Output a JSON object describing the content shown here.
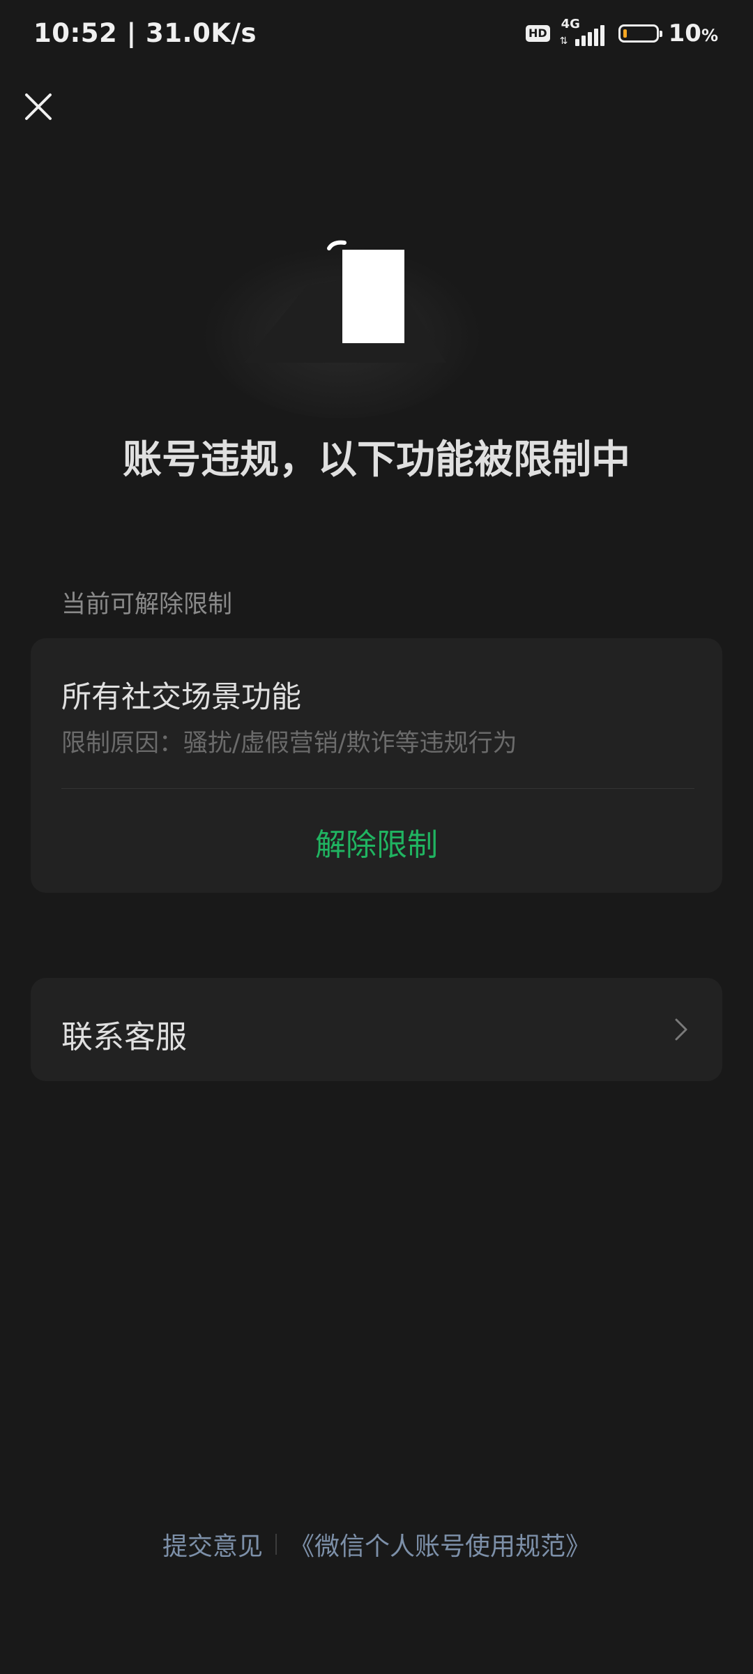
{
  "status_bar": {
    "time_speed": "10:52 | 31.0K/s",
    "hd_label": "HD",
    "network_label": "4G",
    "battery_percent": "10",
    "battery_unit": "%"
  },
  "header": {
    "close_icon": "close-icon"
  },
  "title": "账号违规，以下功能被限制中",
  "section": {
    "label": "当前可解除限制"
  },
  "restriction_card": {
    "title": "所有社交场景功能",
    "reason": "限制原因：骚扰/虚假营销/欺诈等违规行为",
    "action_label": "解除限制"
  },
  "service_card": {
    "label": "联系客服",
    "chevron_icon": "chevron-right-icon"
  },
  "footer": {
    "feedback_label": "提交意见",
    "policy_label": "《微信个人账号使用规范》"
  },
  "colors": {
    "background": "#191919",
    "card": "#222222",
    "accent_green": "#20b461",
    "link_blue": "#7d90a9"
  }
}
